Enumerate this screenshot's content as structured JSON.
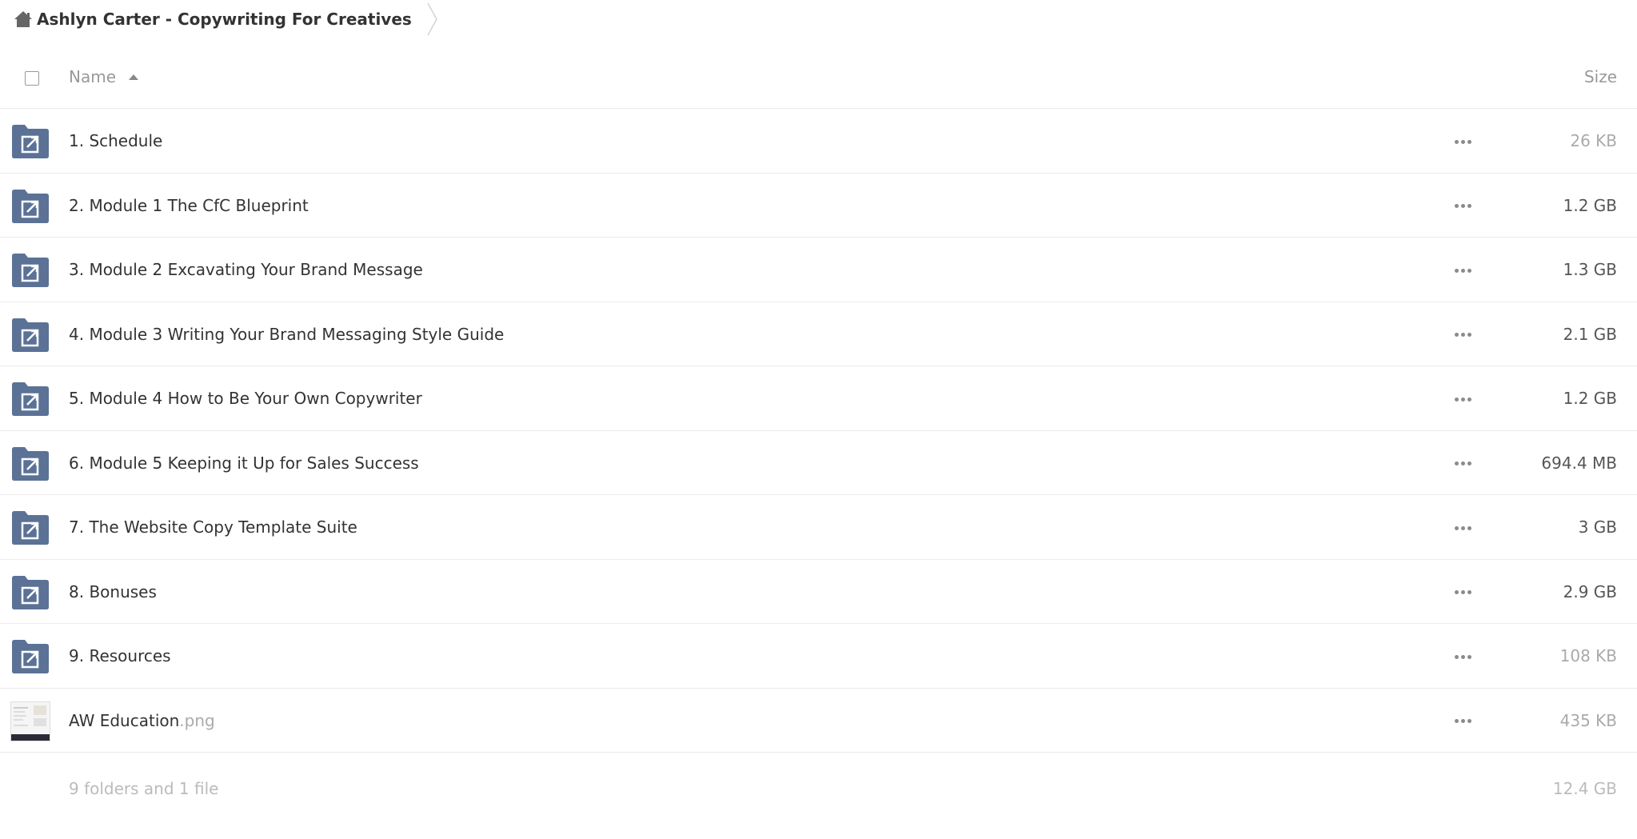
{
  "breadcrumb": {
    "home_icon": "home-icon",
    "title": "Ashlyn Carter - Copywriting For Creatives"
  },
  "header": {
    "name_label": "Name",
    "size_label": "Size",
    "sort": "ascending"
  },
  "colors": {
    "folder": "#5b7296",
    "size_dark": "#555555",
    "size_light": "#aaaaaa"
  },
  "files": [
    {
      "name": "1. Schedule",
      "ext": "",
      "size": "26 KB",
      "type": "shared-folder",
      "size_tone": "light"
    },
    {
      "name": "2. Module 1 The CfC Blueprint",
      "ext": "",
      "size": "1.2 GB",
      "type": "shared-folder",
      "size_tone": "dark"
    },
    {
      "name": "3. Module 2 Excavating Your Brand Message",
      "ext": "",
      "size": "1.3 GB",
      "type": "shared-folder",
      "size_tone": "dark"
    },
    {
      "name": "4. Module 3 Writing Your Brand Messaging Style Guide",
      "ext": "",
      "size": "2.1 GB",
      "type": "shared-folder",
      "size_tone": "dark"
    },
    {
      "name": "5. Module 4 How to Be Your Own Copywriter",
      "ext": "",
      "size": "1.2 GB",
      "type": "shared-folder",
      "size_tone": "dark"
    },
    {
      "name": "6. Module 5 Keeping it Up for Sales Success",
      "ext": "",
      "size": "694.4 MB",
      "type": "shared-folder",
      "size_tone": "dark"
    },
    {
      "name": "7. The Website Copy Template Suite",
      "ext": "",
      "size": "3 GB",
      "type": "shared-folder",
      "size_tone": "dark"
    },
    {
      "name": "8. Bonuses",
      "ext": "",
      "size": "2.9 GB",
      "type": "shared-folder",
      "size_tone": "dark"
    },
    {
      "name": "9. Resources",
      "ext": "",
      "size": "108 KB",
      "type": "shared-folder",
      "size_tone": "light"
    },
    {
      "name": "AW Education",
      "ext": ".png",
      "size": "435 KB",
      "type": "image",
      "size_tone": "light"
    }
  ],
  "summary": {
    "count": "9 folders and 1 file",
    "total": "12.4 GB"
  }
}
